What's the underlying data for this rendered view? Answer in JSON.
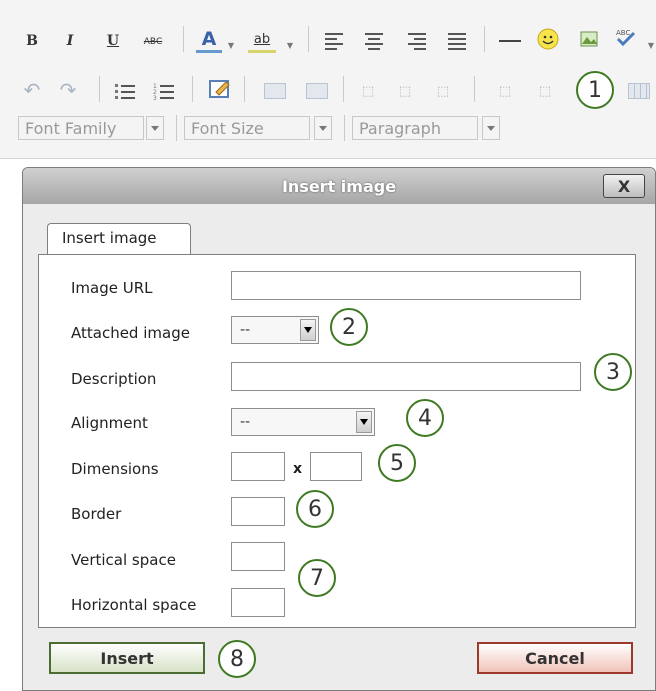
{
  "toolbar": {
    "row1": {
      "bold": "B",
      "italic": "I",
      "underline": "U",
      "strikethrough": "ABC",
      "font_color": "A",
      "highlight": "ab"
    },
    "font_family": "Font Family",
    "font_size": "Font Size",
    "paragraph": "Paragraph"
  },
  "callouts": [
    "1",
    "2",
    "3",
    "4",
    "5",
    "6",
    "7",
    "8"
  ],
  "dialog": {
    "title": "Insert image",
    "close": "X",
    "tab": "Insert image",
    "fields": {
      "image_url": "Image URL",
      "attached_image": "Attached image",
      "attached_image_value": "--",
      "description": "Description",
      "alignment": "Alignment",
      "alignment_value": "--",
      "dimensions": "Dimensions",
      "dimensions_sep": "x",
      "border": "Border",
      "vertical_space": "Vertical space",
      "horizontal_space": "Horizontal space"
    },
    "insert": "Insert",
    "cancel": "Cancel"
  },
  "colors": {
    "callout_border": "#3f7a22",
    "insert_border": "#4b6d33",
    "cancel_border": "#9b3a2b"
  }
}
